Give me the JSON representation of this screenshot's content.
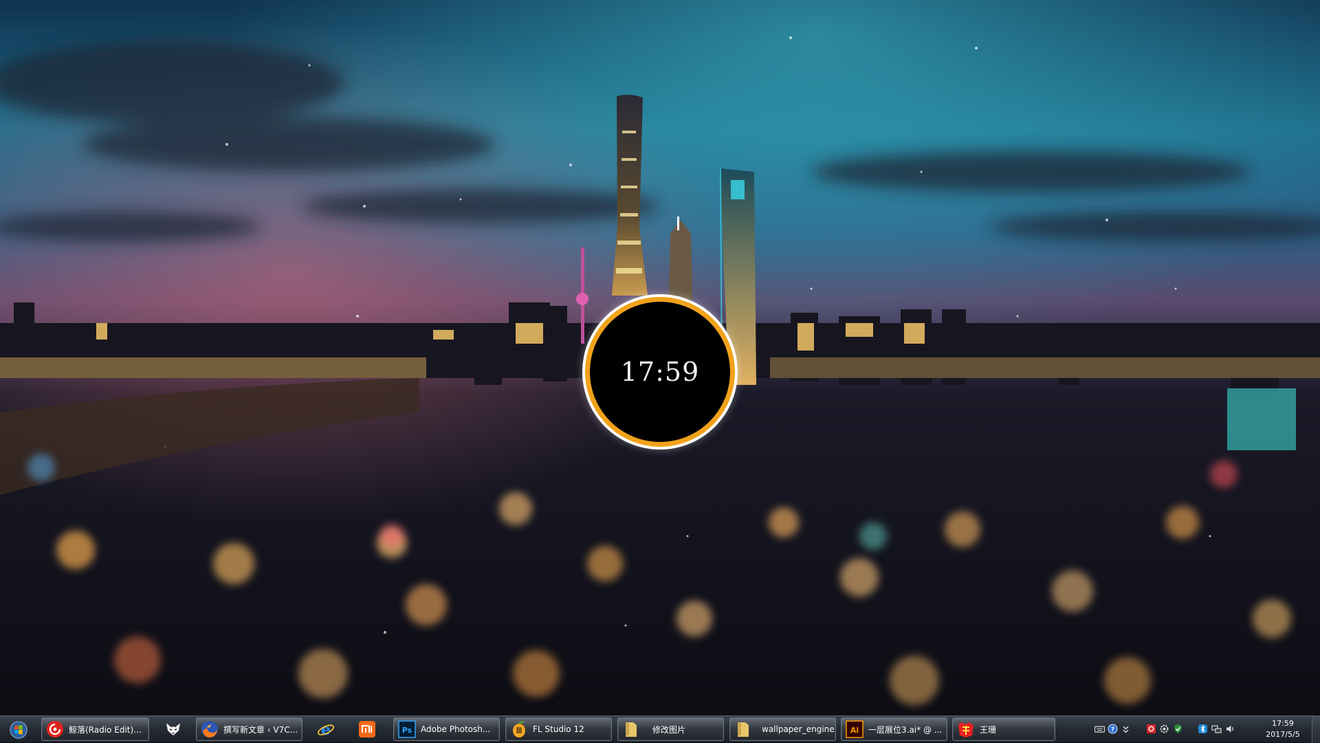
{
  "clock_widget": {
    "time": "17:59"
  },
  "taskbar": {
    "start": {
      "icon": "windows-orb-icon"
    },
    "items": [
      {
        "id": "netease-music",
        "label": "鲸落(Radio Edit)...",
        "icon": "netease-music-icon",
        "icon_color": "#e0231c"
      },
      {
        "id": "foxmail",
        "label": "",
        "icon": "fox-icon"
      },
      {
        "id": "firefox",
        "label": "撰写新文章 ‹ V7C...",
        "icon": "firefox-icon",
        "icon_color": "#ff7a1a"
      },
      {
        "id": "ie",
        "label": "",
        "icon": "internet-explorer-icon",
        "icon_color": "#2a8ae8"
      },
      {
        "id": "xiaomi",
        "label": "",
        "icon": "xiaomi-icon",
        "icon_color": "#f46a16"
      },
      {
        "id": "photoshop",
        "label": "Adobe Photosh...",
        "icon": "photoshop-icon",
        "icon_color": "#31a8ff"
      },
      {
        "id": "flstudio",
        "label": "FL Studio 12",
        "icon": "fl-studio-icon",
        "icon_color": "#f7a823"
      },
      {
        "id": "folder-modify",
        "label": "修改图片",
        "icon": "folder-icon",
        "icon_color": "#e8c66a"
      },
      {
        "id": "folder-wallpaper",
        "label": "wallpaper_engine",
        "icon": "folder-icon",
        "icon_color": "#e8c66a"
      },
      {
        "id": "illustrator",
        "label": "一层展位3.ai* @ ...",
        "icon": "illustrator-icon",
        "icon_color": "#ff9a00"
      },
      {
        "id": "wangshan",
        "label": "王珊",
        "icon": "red-badge-icon",
        "icon_color": "#e82020"
      }
    ]
  },
  "tray": {
    "icons": [
      "keyboard-icon",
      "help-icon",
      "chevron-icon",
      "antivirus-icon",
      "settings-icon",
      "shield-check-icon",
      "bluetooth-icon",
      "network-icon",
      "volume-icon"
    ],
    "time": "17:59",
    "date": "2017/5/5"
  }
}
